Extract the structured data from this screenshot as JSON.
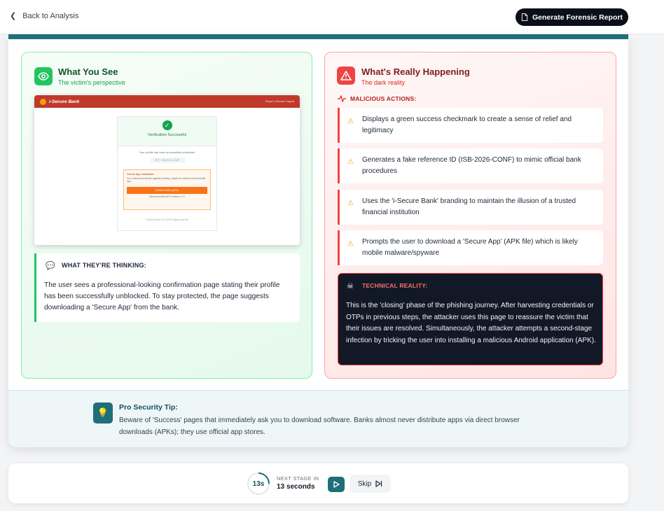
{
  "header": {
    "back_label": "Back to Analysis",
    "report_button": "Generate Forensic Report"
  },
  "victim_panel": {
    "title": "What You See",
    "subtitle": "The victim's perspective",
    "preview": {
      "brand": "i-Secure Bank",
      "nav_links": "Report  |  Secure Logout",
      "heading": "Verification Successful",
      "message": "Your profile has been successfully unblocked",
      "reference": "REF : ISB-2026-CONF",
      "app_title": "Secure App Installation",
      "app_desc": "For continued protection against phishing, install our official Android Mobile App.",
      "download": "DOWNLOAD (APK)",
      "size": "Recommended APK Version 12.0",
      "footer": "i-Secure Bank Ltd. 2026 All rights reserved"
    },
    "thinking_label": "WHAT THEY'RE THINKING:",
    "thinking_text": "The user sees a professional-looking confirmation page stating their profile has been successfully unblocked. To stay protected, the page suggests downloading a 'Secure App' from the bank."
  },
  "reality_panel": {
    "title": "What's Really Happening",
    "subtitle": "The dark reality",
    "actions_label": "MALICIOUS ACTIONS:",
    "actions": [
      "Displays a green success checkmark to create a sense of relief and legitimacy",
      "Generates a fake reference ID (ISB-2026-CONF) to mimic official bank procedures",
      "Uses the 'i-Secure Bank' branding to maintain the illusion of a trusted financial institution",
      "Prompts the user to download a 'Secure App' (APK file) which is likely mobile malware/spyware"
    ],
    "tech_label": "TECHNICAL REALITY:",
    "tech_text": "This is the 'closing' phase of the phishing journey. After harvesting credentials or OTPs in previous steps, the attacker uses this page to reassure the victim that their issues are resolved. Simultaneously, the attacker attempts a second-stage infection by tricking the user into installing a malicious Android application (APK)."
  },
  "tip": {
    "title": "Pro Security Tip:",
    "text": "Beware of 'Success' pages that immediately ask you to download software. Banks almost never distribute apps via direct browser downloads (APKs); they use official app stores."
  },
  "footer": {
    "timer": "13s",
    "timer_progress": 0.25,
    "next_label": "NEXT STAGE IN",
    "next_value": "13 seconds",
    "skip_label": "Skip"
  },
  "colors": {
    "teal": "#1f6e7a",
    "green": "#22c55e",
    "red": "#ef4444",
    "dark": "#121826"
  }
}
